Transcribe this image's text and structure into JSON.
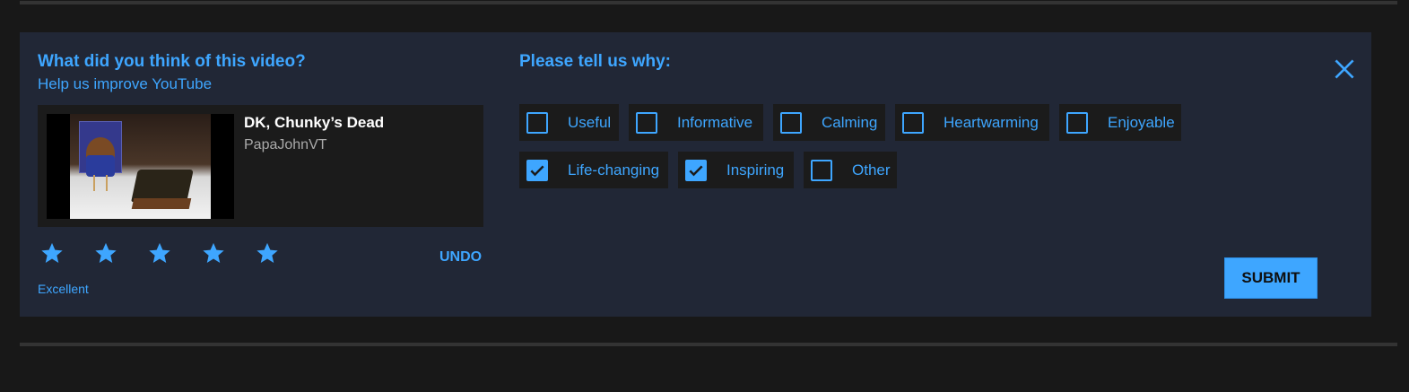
{
  "survey": {
    "title": "What did you think of this video?",
    "subtitle": "Help us improve YouTube",
    "video": {
      "title": "DK, Chunky’s Dead",
      "channel": "PapaJohnVT"
    },
    "rating": {
      "value": 5,
      "max": 5,
      "label": "Excellent",
      "undo_label": "UNDO"
    },
    "reasons": {
      "title": "Please tell us why:",
      "options": [
        {
          "label": "Useful",
          "checked": false
        },
        {
          "label": "Informative",
          "checked": false
        },
        {
          "label": "Calming",
          "checked": false
        },
        {
          "label": "Heartwarming",
          "checked": false
        },
        {
          "label": "Enjoyable",
          "checked": false
        },
        {
          "label": "Life-changing",
          "checked": true
        },
        {
          "label": "Inspiring",
          "checked": true
        },
        {
          "label": "Other",
          "checked": false
        }
      ]
    },
    "submit_label": "SUBMIT",
    "close_icon": "close-icon"
  },
  "colors": {
    "background": "#181818",
    "panel": "#212736",
    "accent": "#3ea6ff",
    "chip": "#1b1b1b"
  }
}
